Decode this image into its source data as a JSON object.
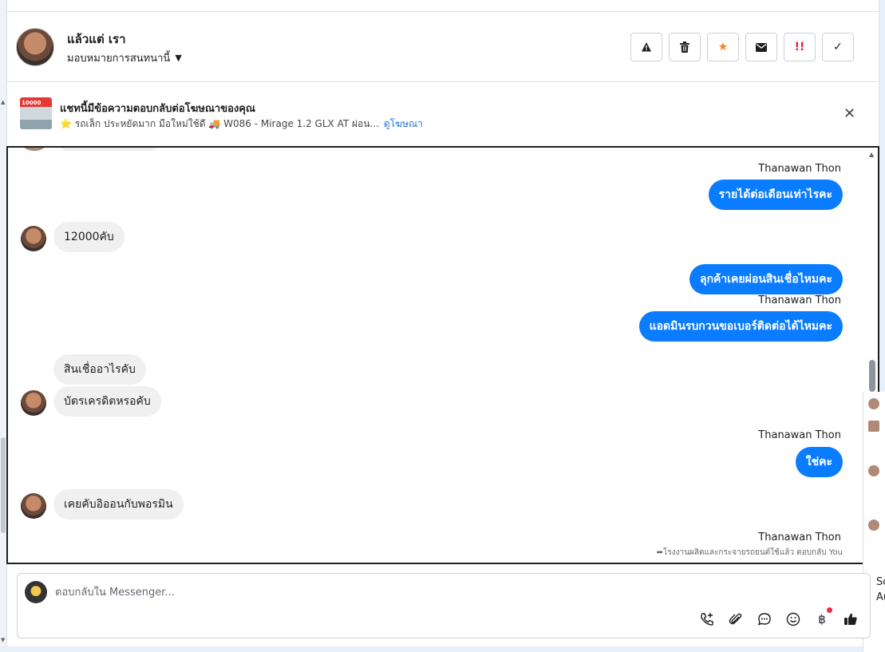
{
  "header": {
    "contact_name": "แล้วแต่ เรา",
    "assign_label": "มอบหมายการสนทนานี้",
    "actions": [
      "spam",
      "delete",
      "star",
      "mark-unread",
      "urgent",
      "done"
    ]
  },
  "ad_banner": {
    "thumb_tag": "10000",
    "title": "แชทนี้มีข้อความตอบกลับต่อโฆษณาของคุณ",
    "subtitle": "⭐ รถเล็ก ประหยัดมาก มือใหม่ใช้ดี 🚚 W086 - Mirage 1.2 GLX AT ผ่อน...",
    "link": "ดูโฆษณา"
  },
  "messages": [
    {
      "dir": "out",
      "sender": "Thanawan Thon",
      "text": "รายได้ต่อเดือนเท่าไรคะ"
    },
    {
      "dir": "in",
      "text": "12000คับ"
    },
    {
      "dir": "out",
      "text": "ลุกค้าเคยผ่อนสินเชื่อไหมคะ"
    },
    {
      "dir": "out",
      "sender": "Thanawan Thon",
      "text": "แอดมินรบกวนขอเบอร์ติดต่อได้ไหมคะ"
    },
    {
      "dir": "in",
      "text": "สินเชื่ออาไรคับ"
    },
    {
      "dir": "in",
      "text": "บัตรเครดิตหรอคับ"
    },
    {
      "dir": "out",
      "sender": "Thanawan Thon",
      "text": "ใช่คะ"
    },
    {
      "dir": "in",
      "text": "เคยคับอิออนกับพอรมิน"
    },
    {
      "dir": "out",
      "sender": "Thanawan Thon"
    }
  ],
  "reply_note": "โรงงานผลิตและกระจายรถยนต์ใช้แล้ว ตอบกลับ You",
  "popover": {
    "line1": "Sc",
    "line2": "Au"
  },
  "composer": {
    "placeholder": "ตอบกลับใน Messenger...",
    "tools": [
      "call-add-icon",
      "attach-icon",
      "chat-bubble-icon",
      "emoji-icon",
      "baht-icon",
      "thumbs-up-icon"
    ]
  }
}
